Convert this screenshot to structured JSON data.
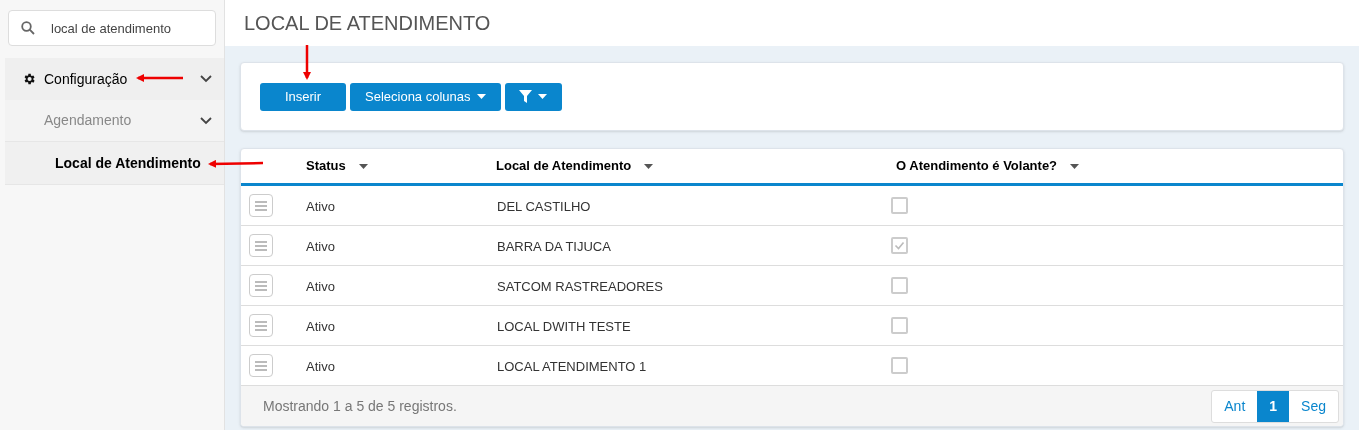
{
  "sidebar": {
    "search": {
      "value": "local de atendimento"
    },
    "items": [
      {
        "label": "Configuração",
        "expanded": true,
        "selected": false,
        "children": [
          {
            "label": "Agendamento",
            "expanded": true,
            "selected": false,
            "children": [
              {
                "label": "Local de Atendimento",
                "selected": true
              }
            ]
          }
        ]
      }
    ]
  },
  "page": {
    "title": "LOCAL DE ATENDIMENTO"
  },
  "toolbar": {
    "buttons": [
      {
        "kind": "plain",
        "label": "Inserir"
      },
      {
        "kind": "dropdown",
        "label": "Seleciona colunas"
      },
      {
        "kind": "filter"
      }
    ]
  },
  "table": {
    "columns": [
      {
        "label": "Status"
      },
      {
        "label": "Local de Atendimento"
      },
      {
        "label": "O Atendimento é Volante?"
      }
    ],
    "rows": [
      {
        "status": "Ativo",
        "local": "DEL CASTILHO",
        "volante": false
      },
      {
        "status": "Ativo",
        "local": "BARRA DA TIJUCA",
        "volante": true
      },
      {
        "status": "Ativo",
        "local": "SATCOM RASTREADORES",
        "volante": false
      },
      {
        "status": "Ativo",
        "local": "LOCAL DWITH TESTE",
        "volante": false
      },
      {
        "status": "Ativo",
        "local": "LOCAL ATENDIMENTO 1",
        "volante": false
      }
    ],
    "summary": "Mostrando 1 a 5 de 5 registros.",
    "pagination": [
      {
        "label": "Ant",
        "selected": false
      },
      {
        "label": "1",
        "selected": true
      },
      {
        "label": "Seg",
        "selected": false
      }
    ]
  }
}
